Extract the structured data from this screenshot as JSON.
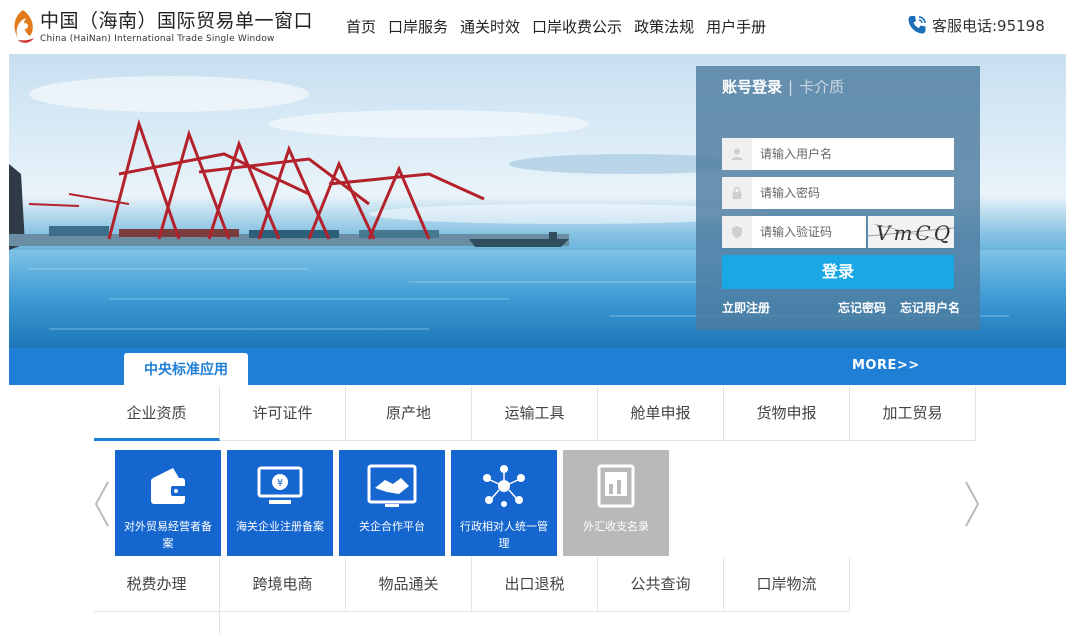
{
  "header": {
    "logo_title": "中国（海南）国际贸易单一窗口",
    "logo_subtitle": "China (HaiNan) International Trade Single Window",
    "nav": [
      "首页",
      "口岸服务",
      "通关时效",
      "口岸收费公示",
      "政策法规",
      "用户手册"
    ],
    "hotline": "客服电话:95198"
  },
  "login": {
    "tab_account": "账号登录",
    "tab_separator": "|",
    "tab_card": "卡介质",
    "username_placeholder": "请输入用户名",
    "password_placeholder": "请输入密码",
    "captcha_placeholder": "请输入验证码",
    "captcha_text": "VmCQ",
    "submit_label": "登录",
    "register_link": "立即注册",
    "forgot_password_link": "忘记密码",
    "forgot_username_link": "忘记用户名"
  },
  "section": {
    "tab_label": "中央标准应用",
    "more_label": "MORE>>"
  },
  "category_tabs_row1": [
    "企业资质",
    "许可证件",
    "原产地",
    "运输工具",
    "舱单申报",
    "货物申报",
    "加工贸易"
  ],
  "category_tabs_row2": [
    "税费办理",
    "跨境电商",
    "物品通关",
    "出口退税",
    "公共查询",
    "口岸物流"
  ],
  "service_cards": [
    {
      "label": "对外贸易经营者备案",
      "icon": "wallet-icon",
      "enabled": true
    },
    {
      "label": "海关企业注册备案",
      "icon": "registration-monitor-icon",
      "enabled": true
    },
    {
      "label": "关企合作平台",
      "icon": "handshake-icon",
      "enabled": true
    },
    {
      "label": "行政相对人统一管理",
      "icon": "people-network-icon",
      "enabled": true
    },
    {
      "label": "外汇收支名录",
      "icon": "directory-icon",
      "enabled": false
    }
  ],
  "colors": {
    "primary_blue": "#1f7fd5",
    "card_blue": "#1666cf",
    "login_button": "#19a7e6",
    "disabled_gray": "#b9b9b9"
  }
}
